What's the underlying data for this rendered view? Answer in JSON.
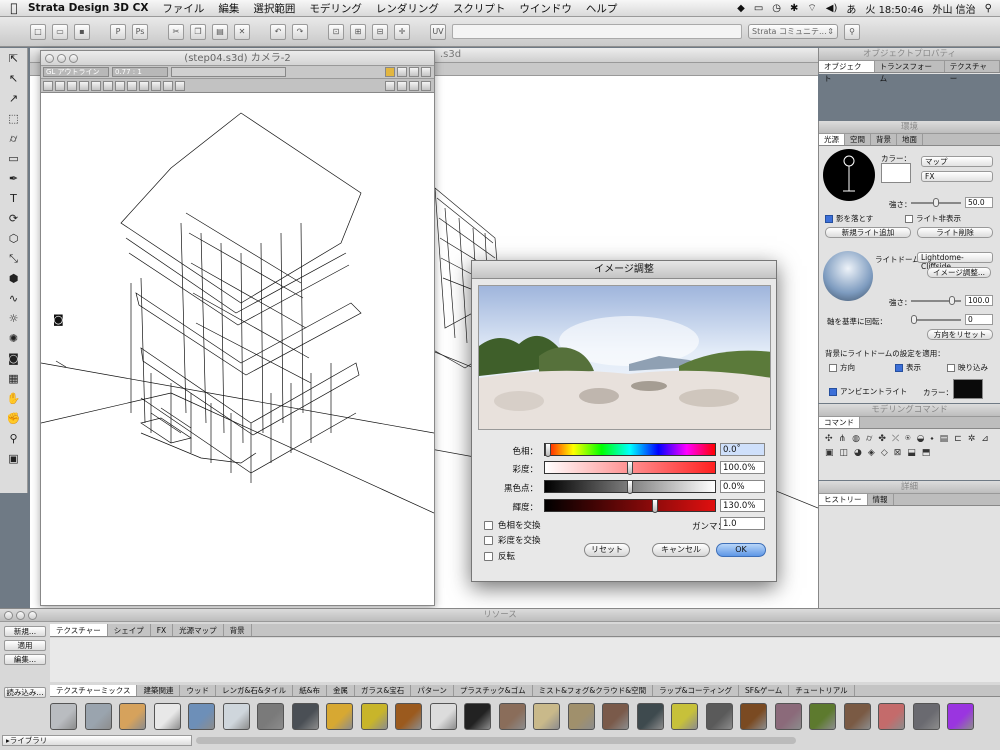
{
  "menubar": {
    "app_name": "Strata Design 3D CX",
    "items": [
      "ファイル",
      "編集",
      "選択範囲",
      "モデリング",
      "レンダリング",
      "スクリプト",
      "ウインドウ",
      "ヘルプ"
    ],
    "clock": "火 18:50:46",
    "user": "外山 信治",
    "input_method": "あ"
  },
  "toolbar": {
    "community_dropdown": "Strata コミュニテ..."
  },
  "viewport": {
    "window_title": "(step04.s3d) カメラ-2",
    "back_title": ".s3d",
    "render_mode": "GL アウトライン",
    "zoom": "0.77 : 1"
  },
  "dialog": {
    "title": "イメージ調整",
    "sliders": [
      {
        "label": "色相：",
        "value": "0.0˚",
        "fill": 0.0
      },
      {
        "label": "彩度：",
        "value": "100.0%",
        "fill": 0.5
      },
      {
        "label": "黒色点：",
        "value": "0.0%",
        "fill": 0.5
      },
      {
        "label": "輝度：",
        "value": "130.0%",
        "fill": 0.65
      }
    ],
    "gamma_label": "ガンマ：",
    "gamma_value": "1.0",
    "checks": [
      "色相を交換",
      "彩度を交換",
      "反転"
    ],
    "buttons": {
      "reset": "リセット",
      "cancel": "キャンセル",
      "ok": "OK"
    }
  },
  "right": {
    "object_panel_title": "オブジェクトプロパティ",
    "object_tabs": [
      "オブジェクト",
      "トランスフォーム",
      "テクスチャー"
    ],
    "env_title": "環境",
    "env_tabs": [
      "光源",
      "空間",
      "背景",
      "地面"
    ],
    "color_label": "カラー：",
    "map_dropdown": "マップ",
    "fx_dropdown": "FX",
    "strength_label": "強さ：",
    "strength_value": "50.0",
    "shadow_label": "影を落とす",
    "light_hide_label": "ライト非表示",
    "add_light": "新規ライト追加",
    "delete_light": "ライト削除",
    "lightdome_label": "ライトドーム：",
    "lightdome_value": "Lightdome-Cliffside",
    "image_adjust_btn": "イメージ調整...",
    "strength2_label": "強さ：",
    "strength2_value": "100.0",
    "rotate_label": "軸を基準に回転：",
    "rotate_value": "0",
    "reset_dir": "方向をリセット",
    "apply_label": "背景にライトドームの設定を適用：",
    "apply_dir": "方向",
    "apply_show": "表示",
    "apply_reflect": "映り込み",
    "ambient_label": "アンビエントライト",
    "ambient_color_label": "カラー：",
    "modeling_title": "モデリングコマンド",
    "command_tab": "コマンド",
    "detail_title": "詳細",
    "history_tabs": [
      "ヒストリー",
      "情報"
    ]
  },
  "resources": {
    "title": "リソース",
    "left_buttons": [
      "新規...",
      "適用",
      "編集..."
    ],
    "load_button": "読み込み...",
    "library_label": "▸ライブラリ",
    "tabs": [
      "テクスチャー",
      "シェイプ",
      "FX",
      "光源マップ",
      "背景"
    ],
    "mix_tabs": [
      "テクスチャーミックス",
      "建築関連",
      "ウッド",
      "レンガ&石&タイル",
      "紙&布",
      "金属",
      "ガラス&宝石",
      "パターン",
      "プラスチック&ゴム",
      "ミスト&フォグ&クラウド&空間",
      "ラップ&コーティング",
      "SF&ゲーム",
      "チュートリアル"
    ],
    "swatch_colors": [
      "#b9bcc0",
      "#9aa4ae",
      "#d6a25c",
      "#e8e8e8",
      "#6d8fb8",
      "#cfd6dc",
      "#7a7a7a",
      "#4a4f55",
      "#d7a832",
      "#c8b52a",
      "#9b5a1e",
      "#dcdcdc",
      "#222222",
      "#8a6d5a",
      "#c9b98a",
      "#a0906c",
      "#7a5a4a",
      "#3e4a4e",
      "#c7c13a",
      "#5a5a5a",
      "#7a4a22",
      "#8b6a7a",
      "#5d7a2e",
      "#7a5a44",
      "#c46b6b",
      "#6a6a70",
      "#9a35e0"
    ]
  }
}
